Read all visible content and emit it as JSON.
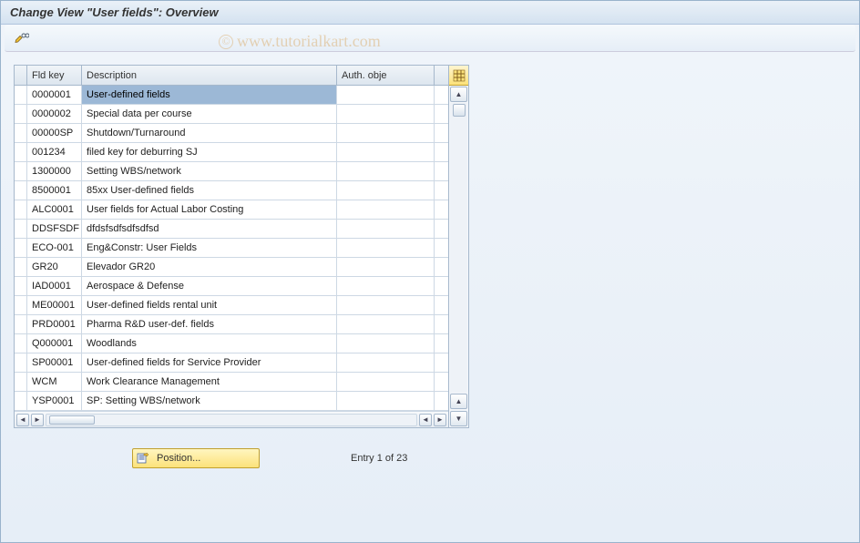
{
  "title": "Change View \"User fields\": Overview",
  "watermark": "www.tutorialkart.com",
  "columns": {
    "key": "Fld key",
    "desc": "Description",
    "auth": "Auth. obje"
  },
  "rows": [
    {
      "key": "0000001",
      "desc": "User-defined fields",
      "auth": ""
    },
    {
      "key": "0000002",
      "desc": "Special data per course",
      "auth": ""
    },
    {
      "key": "00000SP",
      "desc": "Shutdown/Turnaround",
      "auth": ""
    },
    {
      "key": "001234",
      "desc": "filed key for deburring SJ",
      "auth": ""
    },
    {
      "key": "1300000",
      "desc": "Setting WBS/network",
      "auth": ""
    },
    {
      "key": "8500001",
      "desc": "85xx User-defined fields",
      "auth": ""
    },
    {
      "key": "ALC0001",
      "desc": "User fields for Actual Labor Costing",
      "auth": ""
    },
    {
      "key": "DDSFSDF",
      "desc": "dfdsfsdfsdfsdfsd",
      "auth": ""
    },
    {
      "key": "ECO-001",
      "desc": "Eng&Constr: User Fields",
      "auth": ""
    },
    {
      "key": "GR20",
      "desc": "Elevador GR20",
      "auth": ""
    },
    {
      "key": "IAD0001",
      "desc": "Aerospace & Defense",
      "auth": ""
    },
    {
      "key": "ME00001",
      "desc": "User-defined fields rental unit",
      "auth": ""
    },
    {
      "key": "PRD0001",
      "desc": "Pharma R&D user-def. fields",
      "auth": ""
    },
    {
      "key": "Q000001",
      "desc": "Woodlands",
      "auth": ""
    },
    {
      "key": "SP00001",
      "desc": "User-defined fields for Service Provider",
      "auth": ""
    },
    {
      "key": "WCM",
      "desc": "Work Clearance Management",
      "auth": ""
    },
    {
      "key": "YSP0001",
      "desc": "SP: Setting WBS/network",
      "auth": ""
    }
  ],
  "buttons": {
    "position": "Position..."
  },
  "status": "Entry 1 of 23"
}
